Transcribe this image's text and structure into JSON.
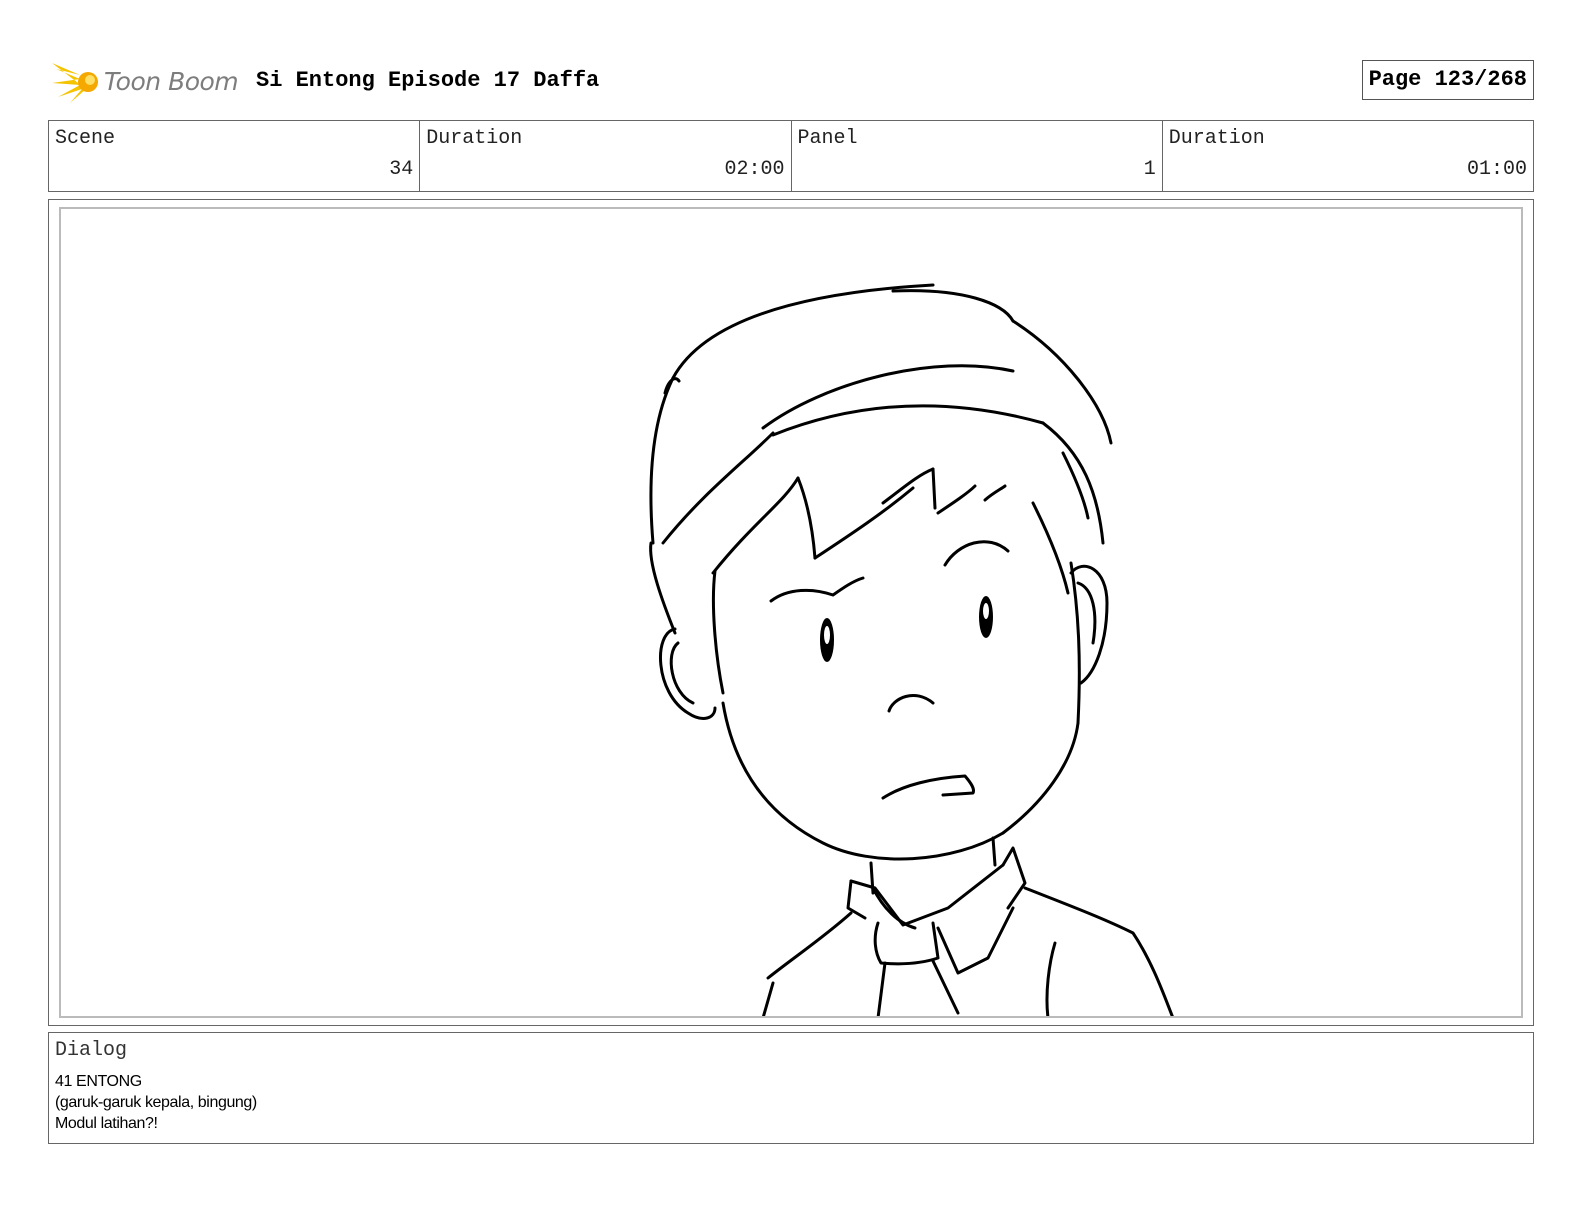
{
  "header": {
    "logo_text": "Toon Boom",
    "title": "Si Entong Episode 17 Daffa",
    "page": "Page 123/268"
  },
  "info": {
    "scene_label": "Scene",
    "scene_value": "34",
    "scene_duration_label": "Duration",
    "scene_duration_value": "02:00",
    "panel_label": "Panel",
    "panel_value": "1",
    "panel_duration_label": "Duration",
    "panel_duration_value": "01:00"
  },
  "panel": {
    "icon": "sketch-boy-face"
  },
  "dialog": {
    "label": "Dialog",
    "lines": [
      "41 ENTONG",
      "(garuk-garuk kepala, bingung)",
      "Modul latihan?!"
    ]
  },
  "colors": {
    "logo_accent": "#f5c400",
    "logo_text": "#7d7d7d",
    "border": "#666666",
    "panel_border": "#bbbbbb"
  }
}
